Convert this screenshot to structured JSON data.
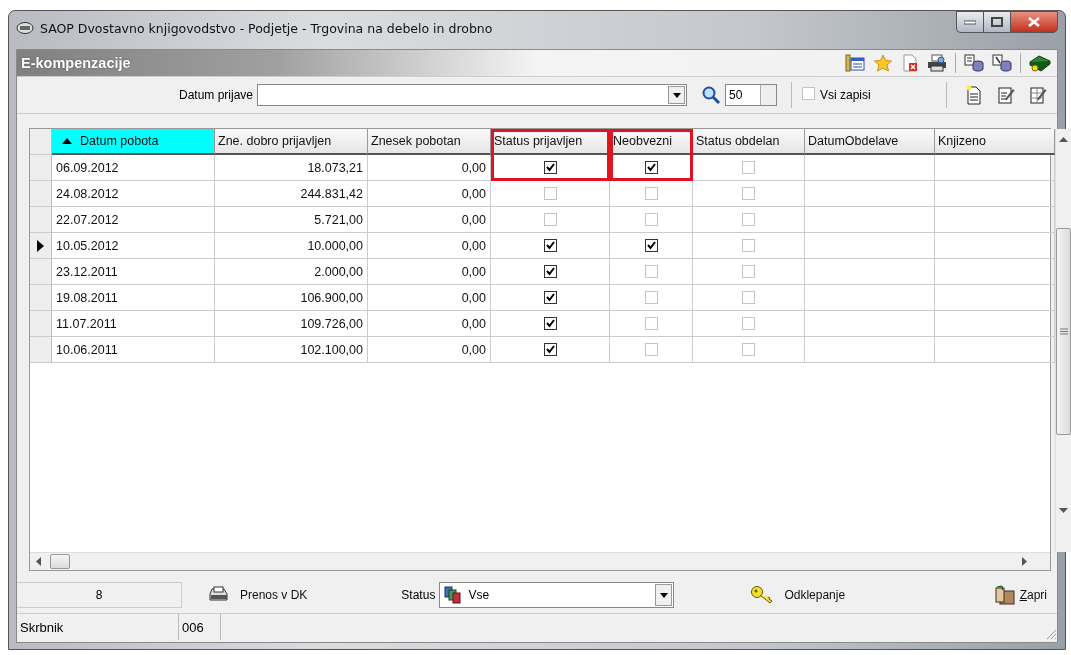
{
  "window": {
    "title": "SAOP Dvostavno knjigovodstvo - Podjetje - Trgovina na debelo in drobno"
  },
  "panel": {
    "title": "E-kompenzacije"
  },
  "filter": {
    "label": "Datum prijave",
    "page_size": "50",
    "all_records": {
      "label": "Vsi zapisi",
      "checked": false
    }
  },
  "table": {
    "columns": [
      {
        "label": "Datum pobota",
        "kind": "text",
        "sorted": true,
        "highlighted": false
      },
      {
        "label": "Zne. dobro prijavljen",
        "kind": "number",
        "sorted": false,
        "highlighted": false
      },
      {
        "label": "Znesek pobotan",
        "kind": "number",
        "sorted": false,
        "highlighted": false
      },
      {
        "label": "Status prijavljen",
        "kind": "check",
        "sorted": false,
        "highlighted": true
      },
      {
        "label": "Neobvezni",
        "kind": "check",
        "sorted": false,
        "highlighted": true
      },
      {
        "label": "Status obdelan",
        "kind": "check",
        "sorted": false,
        "highlighted": false
      },
      {
        "label": "DatumObdelave",
        "kind": "text",
        "sorted": false,
        "highlighted": false
      },
      {
        "label": "Knjizeno",
        "kind": "text",
        "sorted": false,
        "highlighted": false
      }
    ],
    "rows": [
      {
        "selected": false,
        "cells": [
          "06.09.2012",
          "18.073,21",
          "0,00",
          true,
          true,
          false
        ]
      },
      {
        "selected": false,
        "cells": [
          "24.08.2012",
          "244.831,42",
          "0,00",
          false,
          false,
          false
        ]
      },
      {
        "selected": false,
        "cells": [
          "22.07.2012",
          "5.721,00",
          "0,00",
          false,
          false,
          false
        ]
      },
      {
        "selected": true,
        "cells": [
          "10.05.2012",
          "10.000,00",
          "0,00",
          true,
          true,
          false
        ]
      },
      {
        "selected": false,
        "cells": [
          "23.12.2011",
          "2.000,00",
          "0,00",
          true,
          false,
          false
        ]
      },
      {
        "selected": false,
        "cells": [
          "19.08.2011",
          "106.900,00",
          "0,00",
          true,
          false,
          false
        ]
      },
      {
        "selected": false,
        "cells": [
          "11.07.2011",
          "109.726,00",
          "0,00",
          true,
          false,
          false
        ]
      },
      {
        "selected": false,
        "cells": [
          "10.06.2011",
          "102.100,00",
          "0,00",
          true,
          false,
          false
        ]
      }
    ]
  },
  "footer": {
    "count": "8",
    "transfer_button": "Prenos v DK",
    "status_label": "Status",
    "status_value": "Vse",
    "unlock_button": "Odklepanje",
    "close_button": "Zapri"
  },
  "status_bar": [
    "Skrbnik",
    "006"
  ]
}
